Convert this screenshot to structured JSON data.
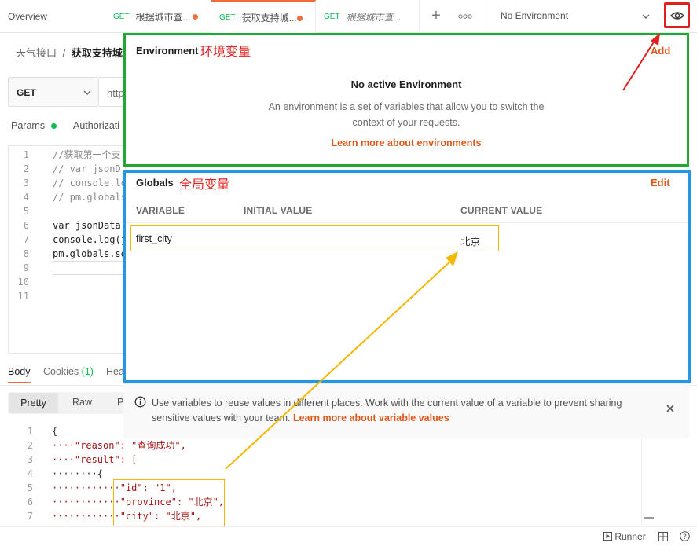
{
  "tabs": {
    "overview": "Overview",
    "items": [
      {
        "method": "GET",
        "label": "根据城市查...",
        "dot": true
      },
      {
        "method": "GET",
        "label": "获取支持城...",
        "dot": true
      },
      {
        "method": "GET",
        "label": "根据城市查..."
      }
    ],
    "env_select": "No Environment"
  },
  "breadcrumb": {
    "parent": "天气接口",
    "sep": "/",
    "current": "获取支持城市"
  },
  "request": {
    "method": "GET",
    "url_prefix": "http"
  },
  "req_tabs": {
    "params": "Params",
    "auth": "Authorizati"
  },
  "script": {
    "line_numbers": [
      "1",
      "2",
      "3",
      "4",
      "5",
      "6",
      "7",
      "8",
      "9",
      "10",
      "11"
    ],
    "lines": [
      "//获取第一个支",
      "// var jsonD",
      "// console.lo",
      "// pm.globals",
      "",
      "var jsonData",
      "console.log(j",
      "pm.globals.se",
      "",
      "",
      ""
    ]
  },
  "response_tabs": {
    "body": "Body",
    "cookies": "Cookies",
    "cookies_count": "(1)",
    "headers": "Hea"
  },
  "view_tabs": {
    "pretty": "Pretty",
    "raw": "Raw",
    "preview": "P"
  },
  "response": {
    "line_numbers": [
      "1",
      "2",
      "3",
      "4",
      "5",
      "6",
      "7"
    ],
    "lines": [
      "{",
      "····\"reason\": \"查询成功\",",
      "····\"result\": [",
      "········{",
      "············\"id\": \"1\",",
      "············\"province\": \"北京\",",
      "············\"city\": \"北京\","
    ]
  },
  "environment": {
    "title": "Environment",
    "annotation": "环境变量",
    "add_label": "Add",
    "empty_title": "No active Environment",
    "empty_desc_1": "An environment is a set of variables that allow you to switch the",
    "empty_desc_2": "context of your requests.",
    "learn_link": "Learn more about environments"
  },
  "globals": {
    "title": "Globals",
    "annotation": "全局变量",
    "edit_label": "Edit",
    "columns": [
      "VARIABLE",
      "INITIAL VALUE",
      "CURRENT VALUE"
    ],
    "rows": [
      {
        "variable": "first_city",
        "initial": "",
        "current": "北京"
      }
    ]
  },
  "note": {
    "text_1": "Use variables to reuse values in different places. Work with the current value of a variable to prevent sharing",
    "text_2": "sensitive values with your team.",
    "link": "Learn more about variable values"
  },
  "status_bar": {
    "runner": "Runner"
  },
  "colors": {
    "accent": "#f26b3a",
    "env_border": "#1fa832",
    "globals_border": "#2496e6",
    "annotation_red": "#e02020",
    "arrow_yellow": "#f5b800"
  }
}
